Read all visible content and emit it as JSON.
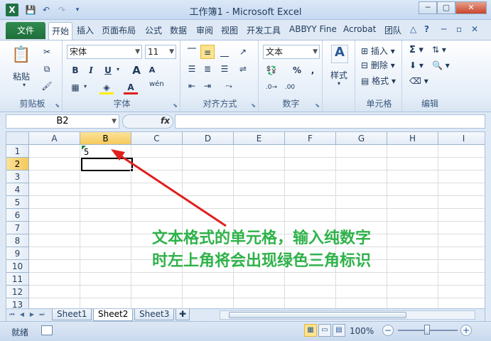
{
  "window": {
    "app_icon": "X",
    "title": "工作簿1 - Microsoft Excel",
    "min": "─",
    "max": "▢",
    "close": "✕"
  },
  "ribbon_tabs": {
    "file": "文件",
    "items": [
      "开始",
      "插入",
      "页面布局",
      "公式",
      "数据",
      "审阅",
      "视图",
      "开发工具",
      "ABBYY Fine",
      "Acrobat",
      "团队"
    ],
    "active": "开始"
  },
  "clipboard": {
    "paste": "粘贴",
    "label": "剪贴板"
  },
  "font": {
    "name": "宋体",
    "size": "11",
    "bold": "B",
    "italic": "I",
    "underline": "U",
    "grow": "A",
    "shrink": "A",
    "label": "字体",
    "phonetic": "wén"
  },
  "alignment": {
    "label": "对齐方式"
  },
  "number": {
    "format": "文本",
    "percent": "%",
    "comma": ",",
    "label": "数字"
  },
  "styles": {
    "label": "样式"
  },
  "cells": {
    "insert": "插入",
    "delete": "删除",
    "format": "格式",
    "label": "单元格"
  },
  "editing": {
    "sum": "Σ",
    "label": "编辑"
  },
  "formula_bar": {
    "name_box": "B2",
    "fx": "fx",
    "content": ""
  },
  "grid": {
    "columns": [
      "A",
      "B",
      "C",
      "D",
      "E",
      "F",
      "G",
      "H",
      "I"
    ],
    "rows": [
      "1",
      "2",
      "3",
      "4",
      "5",
      "6",
      "7",
      "8",
      "9",
      "10",
      "11",
      "12",
      "13"
    ],
    "selected_column": "B",
    "selected_row": "2",
    "cell_b1": "5"
  },
  "annotation": {
    "line1": "文本格式的单元格，输入纯数字",
    "line2": "时左上角将会出现绿色三角标识"
  },
  "sheets": {
    "tabs": [
      "Sheet1",
      "Sheet2",
      "Sheet3"
    ],
    "active": "Sheet2"
  },
  "status": {
    "ready": "就绪",
    "zoom": "100%",
    "minus": "−",
    "plus": "+"
  },
  "colors": {
    "file_tab": "#1f6e3b",
    "annotation": "#2fb24a",
    "arrow": "#e0201c",
    "error_triangle": "#1a8a3a",
    "selected_header": "#f5c95a"
  }
}
